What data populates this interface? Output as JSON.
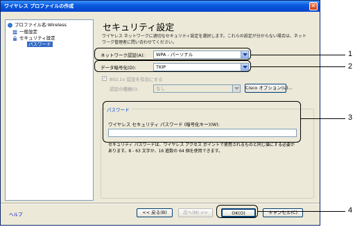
{
  "window": {
    "title": "ワイヤレス プロファイルの作成",
    "close_glyph": "✕"
  },
  "tree": {
    "root": "プロファイル名:Wireless",
    "items": [
      "一般設定",
      "セキュリティ設定",
      "パスワード"
    ]
  },
  "help": {
    "label": "ヘルプ"
  },
  "page": {
    "title": "セキュリティ設定",
    "description": "ワイヤレス ネットワークに適切なセキュリティ設定を選択します。これらの設定が分からない場合は、ネットワーク管理者に問い合わせてください。"
  },
  "form": {
    "network_auth_label": "ネットワーク認証(A):",
    "network_auth_value": "WPA - パーソナル",
    "encryption_label": "データ暗号化(D):",
    "encryption_value": "TKIP",
    "enable_8021x_label": "802.1x 認証を有効にする",
    "auth_type_label": "認証の種類(I):",
    "auth_type_value": "なし",
    "cisco_button": "Cisco オプション(U)...",
    "password_group": "パスワード",
    "wireless_password_label": "ワイヤレス セキュリティ パスワード (暗号化キー)(W):",
    "wireless_password_value": "",
    "password_note": "セキュリティ パスワードは、ワイヤレス アクセス ポイントで使用されるものと同じ値にする必要があります。8 - 63 文字か、16 進数の 64 個を使用できます。"
  },
  "buttons": {
    "back": "<< 戻る(B)",
    "next": "次へ(N) >>",
    "ok": "OK(O)",
    "cancel": "キャンセル(C)"
  },
  "callouts": [
    "1",
    "2",
    "3",
    "4"
  ]
}
